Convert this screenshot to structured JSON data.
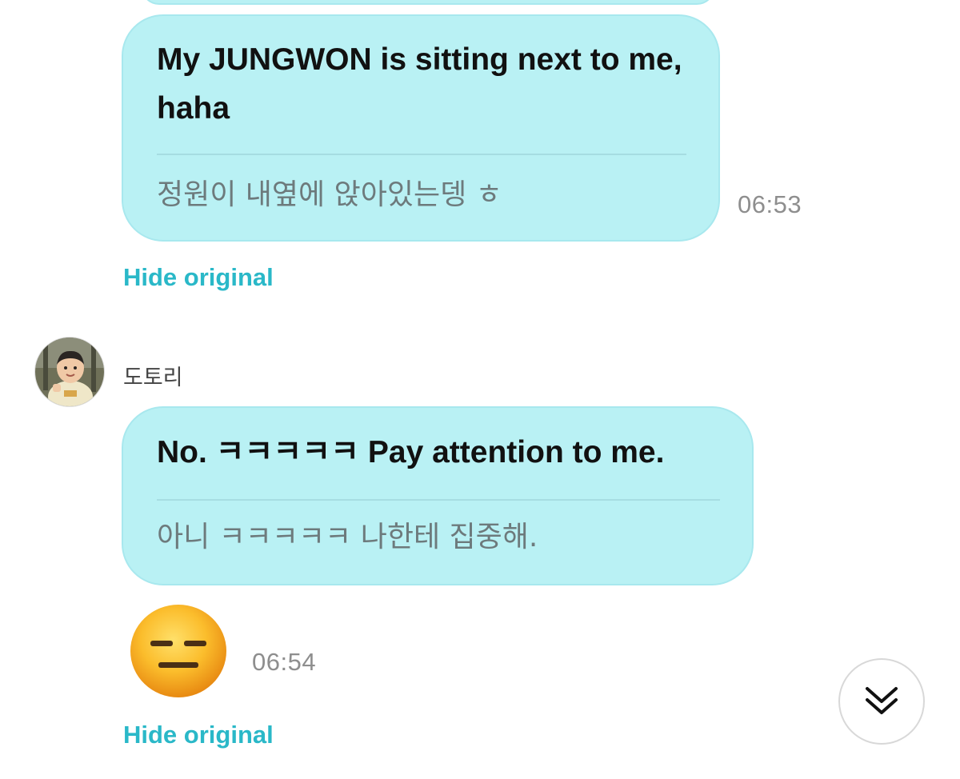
{
  "messages": [
    {
      "translated": "My JUNGWON is sitting next to me, haha",
      "original": "정원이 내옆에 앉아있는뎅 ㅎ",
      "time": "06:53",
      "hide_label": "Hide original"
    },
    {
      "sender": "도토리",
      "translated": "No. ㅋㅋㅋㅋㅋ Pay attention to me.",
      "original": "아니 ㅋㅋㅋㅋㅋ 나한테 집중해.",
      "time": "06:54",
      "hide_label": "Hide original",
      "emoji": "expressionless-face-emoji"
    }
  ],
  "scroll_button": {
    "icon": "double-chevron-down-icon"
  },
  "colors": {
    "bubble": "#b9f1f4",
    "bubble_border": "#a8e8ee",
    "link": "#2ab8c8",
    "timestamp": "#8e8e8e"
  }
}
